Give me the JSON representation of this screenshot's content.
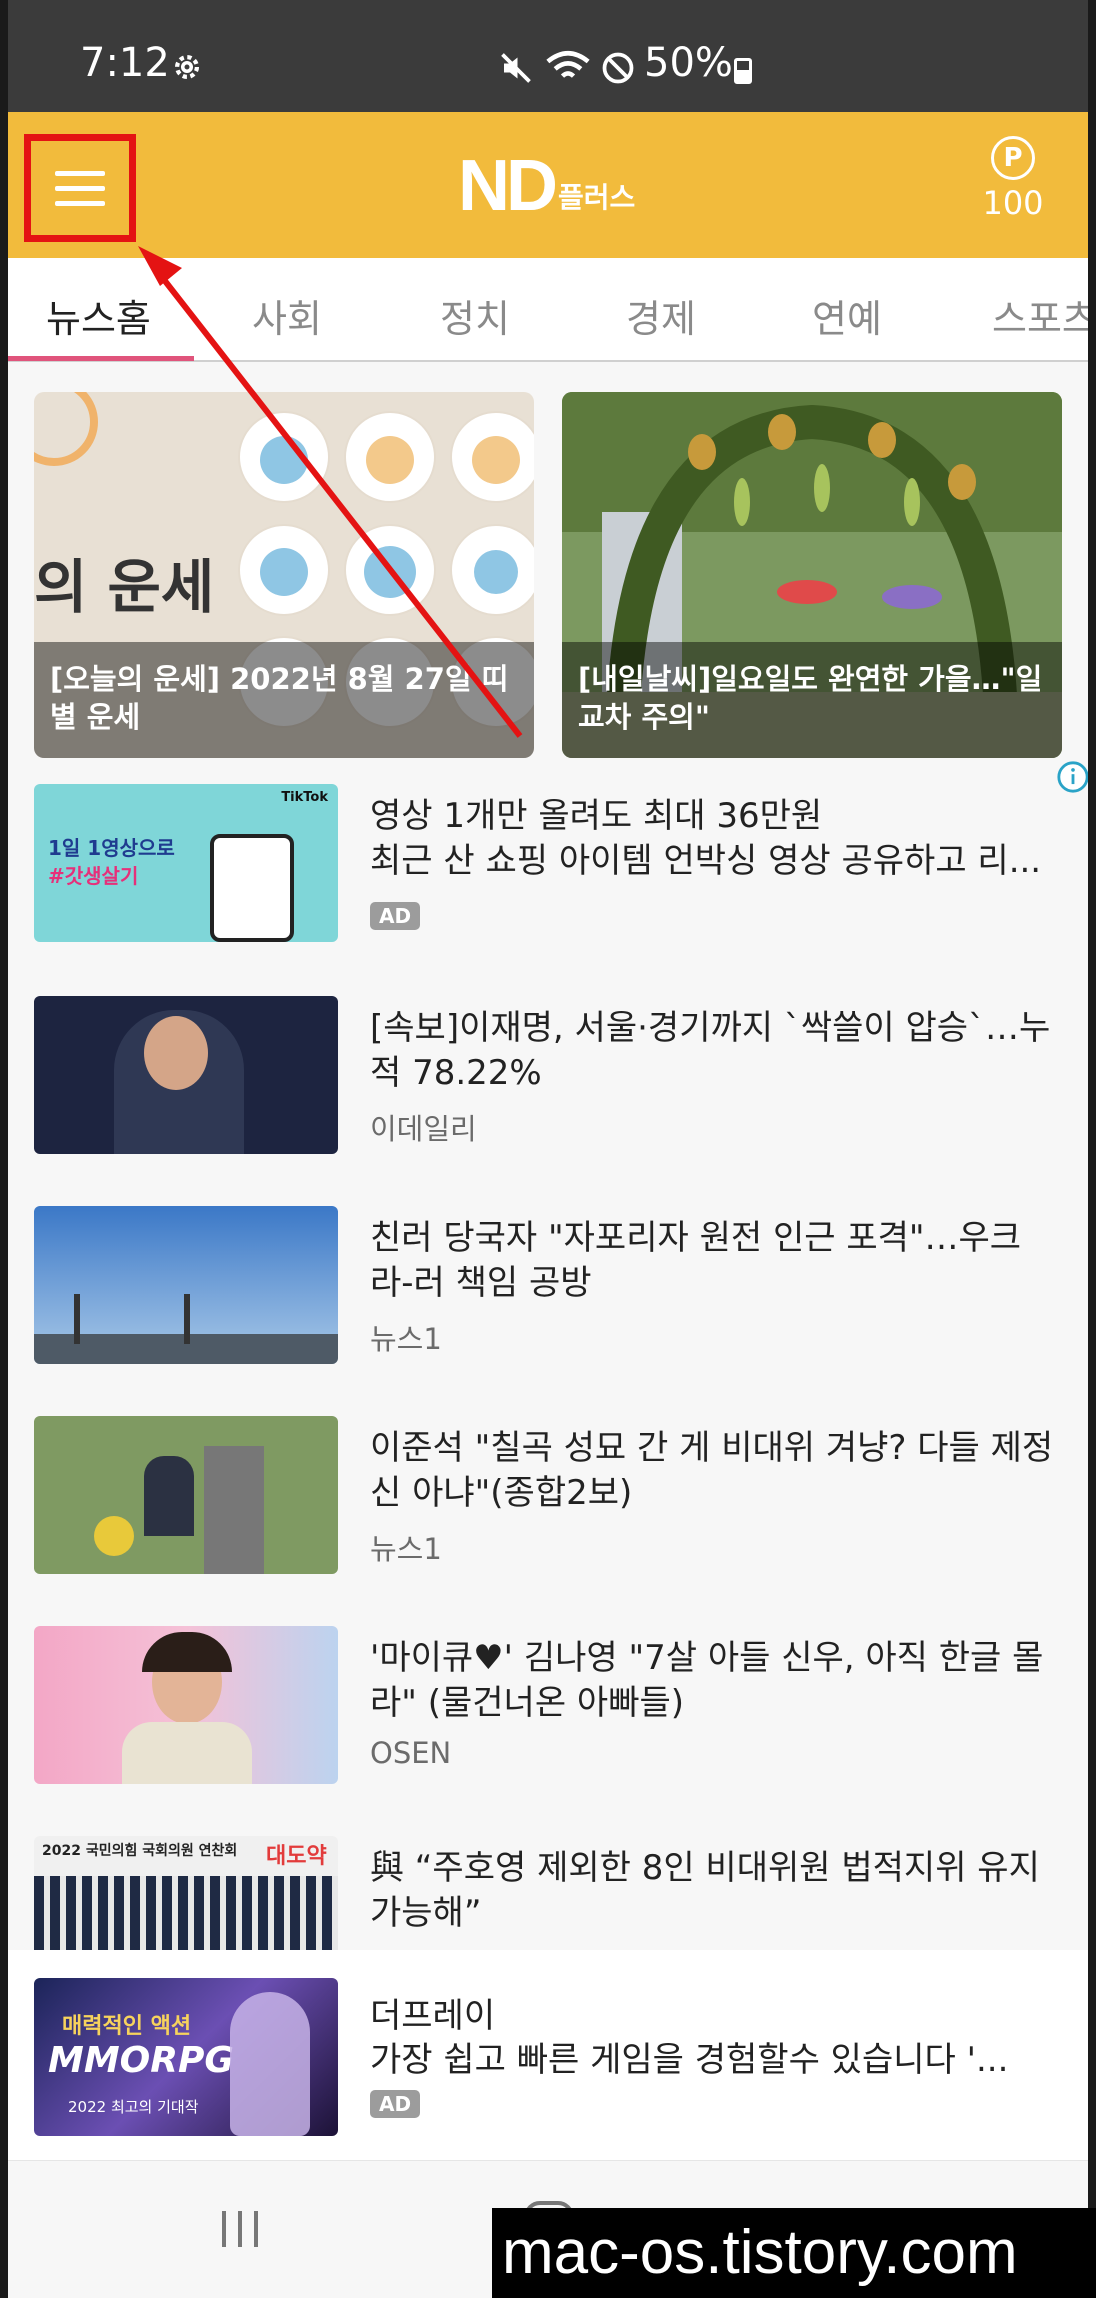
{
  "status_bar": {
    "time": "7:12",
    "battery": "50%"
  },
  "app": {
    "logo_main": "ND",
    "logo_sub": "플러스",
    "points_symbol": "P",
    "points_value": "100"
  },
  "tabs": [
    {
      "label": "뉴스홈",
      "active": true
    },
    {
      "label": "사회",
      "active": false
    },
    {
      "label": "정치",
      "active": false
    },
    {
      "label": "경제",
      "active": false
    },
    {
      "label": "연예",
      "active": false
    },
    {
      "label": "스포츠",
      "active": false
    }
  ],
  "featured": [
    {
      "caption": "[오늘의 운세] 2022년 8월 27일 띠별 운세",
      "bg_text": "의 운세"
    },
    {
      "caption": "[내일날씨]일요일도 완연한 가을…\"일교차 주의\""
    }
  ],
  "list": [
    {
      "title": "영상 1개만 올려도 최대 36만원\n최근 산 쇼핑 아이템 언박싱 영상 공유하고 리...",
      "badge": "AD",
      "thumb_text": [
        "1일 1영상으로",
        "#갓생살기"
      ],
      "thumb_brand": "TikTok"
    },
    {
      "title": "[속보]이재명, 서울·경기까지 `싹쓸이 압승`…누적 78.22%",
      "source": "이데일리"
    },
    {
      "title": "친러 당국자 \"자포리자 원전 인근 포격\"…우크라-러 책임 공방",
      "source": "뉴스1"
    },
    {
      "title": "이준석 \"칠곡 성묘 간 게 비대위 겨냥? 다들 제정신 아냐\"(종합2보)",
      "source": "뉴스1"
    },
    {
      "title": "'마이큐♥' 김나영 \"7살 아들 신우, 아직 한글 몰라\" (물건너온 아빠들)",
      "source": "OSEN"
    },
    {
      "title": "與 “주호영 제외한 8인 비대위원 법적지위 유지 가능해”",
      "thumb_text": [
        "2022 국민의힘 국회의원 연찬회",
        "대도약"
      ]
    }
  ],
  "bottom_ad": {
    "title": "더프레이",
    "desc": "가장 쉽고 빠른 게임을 경험할수 있습니다  '...",
    "badge": "AD",
    "thumb_text": [
      "매력적인 액션",
      "MMORPG",
      "2022 최고의 기대작"
    ]
  },
  "watermark": "mac-os.tistory.com",
  "colors": {
    "appbar": "#f2bb3c",
    "highlight": "#e41313",
    "tab_underline": "#e0547b"
  }
}
